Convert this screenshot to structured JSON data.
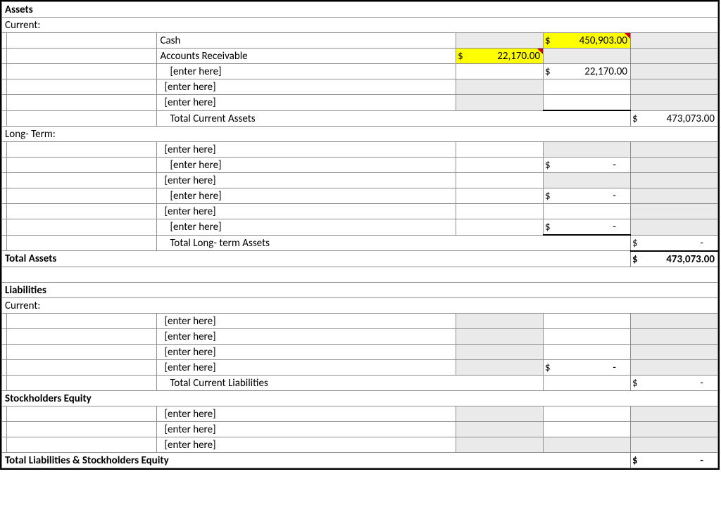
{
  "sections": {
    "assets": "Assets",
    "current": "Current:",
    "longterm": "Long- Term:",
    "total_assets": "Total Assets",
    "liabilities": "Liabilities",
    "se": "Stockholders Equity",
    "tlse": "Total Liabilities & Stockholders Equity"
  },
  "labels": {
    "cash": "Cash",
    "ar": "Accounts Receivable",
    "enter": "[enter here]",
    "tca": "Total Current Assets",
    "tlta": "Total Long- term Assets",
    "tcl": "Total Current Liabilities"
  },
  "sym": "$",
  "dash": "-",
  "values": {
    "cash": "450,903.00",
    "ar_d": "22,170.00",
    "ar_sum": "22,170.00",
    "tca": "473,073.00",
    "ta": "473,073.00"
  }
}
